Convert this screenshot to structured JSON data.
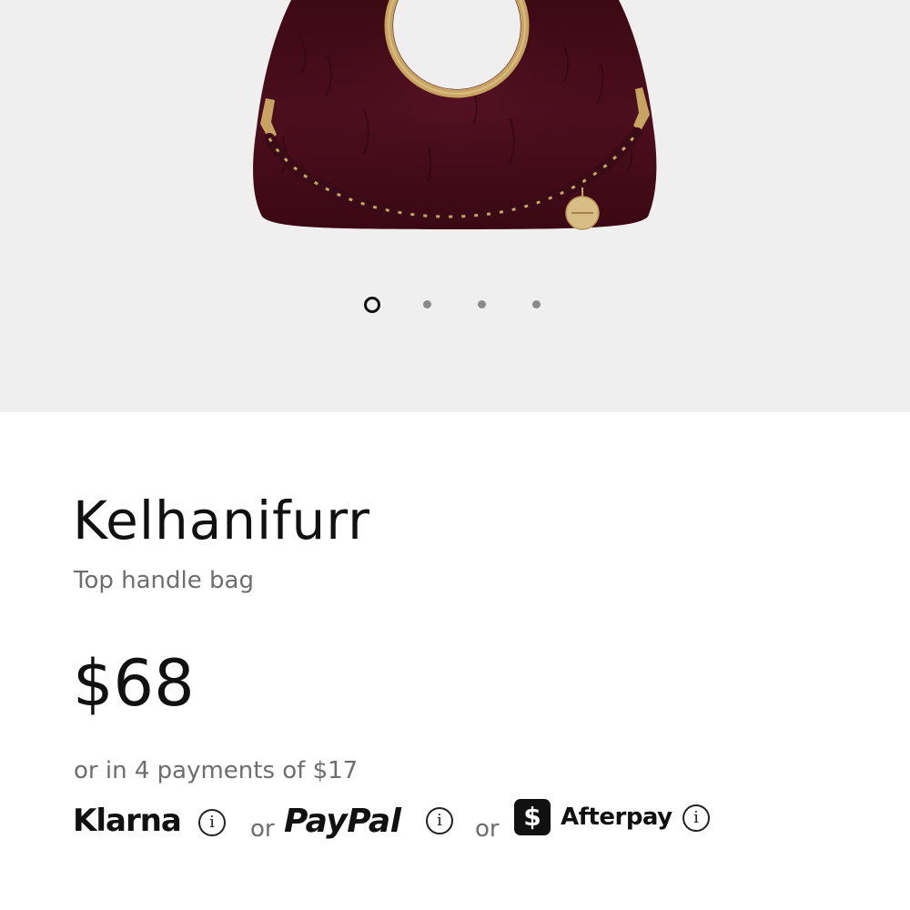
{
  "gallery": {
    "image_subject": "burgundy faux fur top handle bag with gold ring handle and braided chain strap",
    "image_count": 4,
    "active_index": 0
  },
  "product": {
    "name": "Kelhanifurr",
    "category": "Top handle bag",
    "price": "$68",
    "installments": "or in 4 payments of $17"
  },
  "payments": {
    "klarna": "Klarna",
    "paypal": "PayPal",
    "afterpay": "Afterpay",
    "afterpay_badge": "$",
    "or": "or",
    "info_glyph": "i"
  },
  "colors": {
    "gallery_bg": "#efefef",
    "bag": "#4a0d1c",
    "gold": "#c8a462",
    "text_primary": "#111111",
    "text_secondary": "#6e6e6e"
  }
}
